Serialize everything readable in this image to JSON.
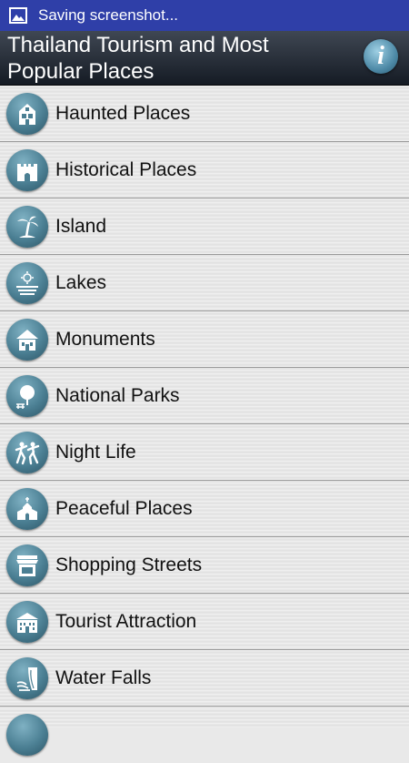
{
  "statusbar": {
    "text": "Saving screenshot..."
  },
  "header": {
    "title": "Thailand Tourism and Most Popular Places",
    "info_icon": "info-icon"
  },
  "categories": [
    {
      "label": "Haunted Places",
      "icon": "haunted-house-icon"
    },
    {
      "label": "Historical Places",
      "icon": "castle-icon"
    },
    {
      "label": "Island",
      "icon": "palm-tree-icon"
    },
    {
      "label": "Lakes",
      "icon": "lake-icon"
    },
    {
      "label": "Monuments",
      "icon": "monument-icon"
    },
    {
      "label": "National Parks",
      "icon": "tree-icon"
    },
    {
      "label": "Night Life",
      "icon": "dancers-icon"
    },
    {
      "label": "Peaceful Places",
      "icon": "church-icon"
    },
    {
      "label": "Shopping Streets",
      "icon": "shop-icon"
    },
    {
      "label": "Tourist Attraction",
      "icon": "building-icon"
    },
    {
      "label": "Water Falls",
      "icon": "waterfall-icon"
    }
  ],
  "colors": {
    "statusbar": "#2f3fa8",
    "icon_teal": "#4b7f93"
  }
}
